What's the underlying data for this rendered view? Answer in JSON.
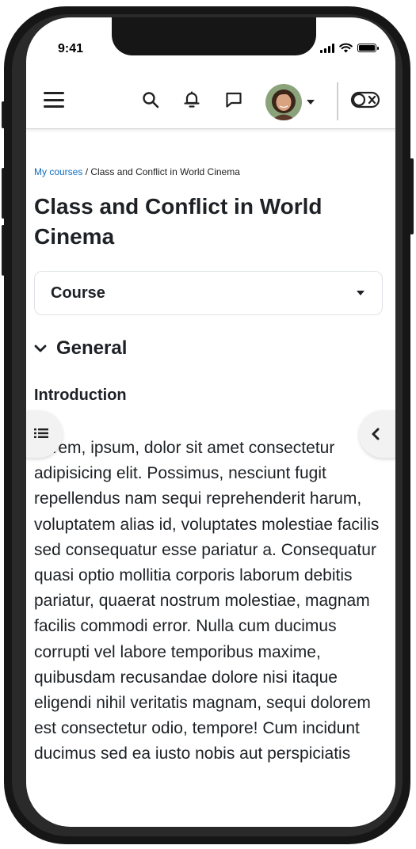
{
  "status_bar": {
    "time": "9:41"
  },
  "header": {
    "menu_icon": "hamburger-menu-icon",
    "search_icon": "search-icon",
    "notifications_icon": "bell-icon",
    "messages_icon": "chat-bubble-icon",
    "user_menu_icon": "chevron-down-icon",
    "edit_mode_toggle_icon": "toggle-switch-off-icon"
  },
  "breadcrumb": {
    "link_label": "My courses",
    "separator": " / ",
    "current": "Class and Conflict in World Cinema"
  },
  "page_title": "Class and Conflict in World Cinema",
  "course_nav": {
    "selected": "Course"
  },
  "section": {
    "title": "General",
    "subheading": "Introduction",
    "body": "Lorem, ipsum, dolor sit amet consectetur adipisicing elit. Possimus, nesciunt fugit repellendus nam sequi reprehenderit harum, voluptatem alias id, voluptates molestiae facilis sed consequatur esse pariatur a. Consequatur quasi optio mollitia corporis laborum debitis pariatur, quaerat nostrum molestiae, magnam facilis commodi error. Nulla cum ducimus corrupti vel labore temporibus maxime, quibusdam recusandae dolore nisi itaque eligendi nihil veritatis magnam, sequi dolorem est consectetur odio, tempore! Cum incidunt ducimus sed ea iusto nobis aut perspiciatis"
  },
  "drawers": {
    "left_icon": "course-index-list-icon",
    "right_icon": "chevron-left-icon"
  },
  "colors": {
    "link": "#0f6cbf",
    "text": "#1d2125",
    "frame": "#161616"
  }
}
